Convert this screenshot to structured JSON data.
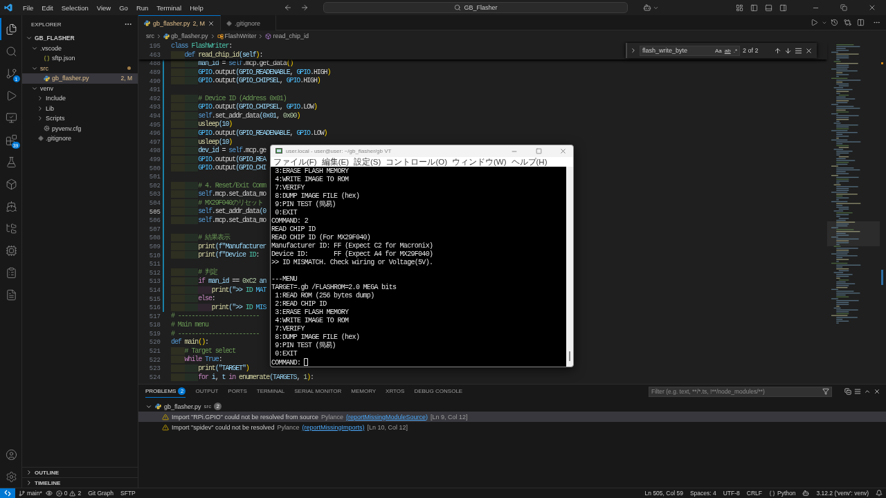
{
  "title_bar": {
    "menus": [
      "File",
      "Edit",
      "Selection",
      "View",
      "Go",
      "Run",
      "Terminal",
      "Help"
    ],
    "search": "GB_Flasher"
  },
  "activity_bar": [
    {
      "kind": "explorer",
      "selected": true
    },
    {
      "kind": "search",
      "selected": false
    },
    {
      "kind": "source_control",
      "selected": false,
      "badge": "1"
    },
    {
      "kind": "run",
      "selected": false
    },
    {
      "kind": "remote",
      "selected": false
    },
    {
      "kind": "extensions",
      "selected": false,
      "badge": "39"
    },
    {
      "kind": "testing",
      "selected": false
    },
    {
      "kind": "containers",
      "selected": false
    },
    {
      "kind": "docker",
      "selected": false
    },
    {
      "kind": "folders",
      "selected": false
    },
    {
      "kind": "device",
      "selected": false
    },
    {
      "kind": "clipboard",
      "selected": false
    },
    {
      "kind": "notes",
      "selected": false
    }
  ],
  "sidebar": {
    "title": "EXPLORER",
    "root": {
      "label": "GB_FLASHER",
      "expanded": true
    },
    "tree": [
      {
        "label": ".vscode",
        "kind": "folder",
        "expanded": true,
        "selected": false,
        "modified": false,
        "children": [
          {
            "label": "sftp.json",
            "kind": "json",
            "selected": false,
            "modified": false
          }
        ]
      },
      {
        "label": "src",
        "kind": "folder",
        "expanded": true,
        "selected": false,
        "modified": true,
        "children": [
          {
            "label": "gb_flasher.py",
            "kind": "python",
            "selected": true,
            "modified": true,
            "badge": "2, M"
          }
        ]
      },
      {
        "label": "venv",
        "kind": "folder",
        "expanded": true,
        "selected": false,
        "modified": false,
        "children": [
          {
            "label": "Include",
            "kind": "folder",
            "expanded": false,
            "selected": false,
            "modified": false
          },
          {
            "label": "Lib",
            "kind": "folder",
            "expanded": false,
            "selected": false,
            "modified": false
          },
          {
            "label": "Scripts",
            "kind": "folder",
            "expanded": false,
            "selected": false,
            "modified": false
          },
          {
            "label": "pyvenv.cfg",
            "kind": "config",
            "selected": false,
            "modified": false
          }
        ]
      },
      {
        "label": ".gitignore",
        "kind": "ignore",
        "selected": false,
        "modified": false
      }
    ],
    "sections": [
      {
        "label": "OUTLINE",
        "expanded": false
      },
      {
        "label": "TIMELINE",
        "expanded": false
      }
    ]
  },
  "tabs": [
    {
      "label": "gb_flasher.py",
      "kind": "python",
      "badge": "2, M",
      "selected": true,
      "modified": true
    },
    {
      "label": ".gitignore",
      "kind": "ignore",
      "selected": false,
      "modified": false
    }
  ],
  "breadcrumb": [
    {
      "label": "src",
      "kind": "folder"
    },
    {
      "label": "gb_flasher.py",
      "kind": "python"
    },
    {
      "label": "FlashWriter",
      "kind": "class"
    },
    {
      "label": "read_chip_id",
      "kind": "method"
    }
  ],
  "find": {
    "query": "flash_write_byte",
    "options": [
      "Aa",
      "ab",
      ".*"
    ],
    "count": "2 of 2"
  },
  "editor": {
    "sticky": [
      {
        "n": "195",
        "text": "class FlashWriter:"
      },
      {
        "n": "463",
        "text": "    def read_chip_id(self):"
      }
    ],
    "lines": [
      {
        "n": "488",
        "text": "        man_id = self.mcp.get_data()",
        "changed": true,
        "current": false
      },
      {
        "n": "489",
        "text": "        GPIO.output(GPIO_READENABLE, GPIO.HIGH)",
        "changed": true,
        "current": false
      },
      {
        "n": "490",
        "text": "        GPIO.output(GPIO_CHIPSEL, GPIO.HIGH)",
        "changed": true,
        "current": false
      },
      {
        "n": "491",
        "changed": true,
        "current": false
      },
      {
        "n": "492",
        "text": "        # Device ID (Address 0x01)",
        "changed": true,
        "current": false
      },
      {
        "n": "493",
        "text": "        GPIO.output(GPIO_CHIPSEL, GPIO.LOW)",
        "changed": true,
        "current": false
      },
      {
        "n": "494",
        "text": "        self.set_addr_data(0x01, 0x00)",
        "changed": true,
        "current": false
      },
      {
        "n": "495",
        "text": "        usleep(10)",
        "changed": true,
        "current": false
      },
      {
        "n": "496",
        "text": "        GPIO.output(GPIO_READENABLE, GPIO.LOW)",
        "changed": true,
        "current": false
      },
      {
        "n": "497",
        "text": "        usleep(10)",
        "changed": true,
        "current": false
      },
      {
        "n": "498",
        "text": "        dev_id = self.mcp.ge",
        "changed": true,
        "current": false
      },
      {
        "n": "499",
        "text": "        GPIO.output(GPIO_REA",
        "changed": true,
        "current": false
      },
      {
        "n": "500",
        "text": "        GPIO.output(GPIO_CHI",
        "changed": true,
        "current": false
      },
      {
        "n": "501",
        "changed": true,
        "current": false
      },
      {
        "n": "502",
        "text": "        # 4. Reset/Exit Comm",
        "changed": true,
        "current": false
      },
      {
        "n": "503",
        "text": "        self.mcp.set_data_mo",
        "changed": true,
        "current": false
      },
      {
        "n": "504",
        "text": "        # MX29F040のリセット",
        "changed": true,
        "current": false
      },
      {
        "n": "505",
        "text": "        self.set_addr_data(0",
        "changed": true,
        "current": true
      },
      {
        "n": "506",
        "text": "        self.mcp.set_data_mo",
        "changed": true,
        "current": false
      },
      {
        "n": "507",
        "changed": true,
        "current": false
      },
      {
        "n": "508",
        "text": "        # 結果表示",
        "changed": true,
        "current": false
      },
      {
        "n": "509",
        "text": "        print(f\"Manufacturer",
        "changed": true,
        "current": false
      },
      {
        "n": "510",
        "text": "        print(f\"Device ID:",
        "changed": true,
        "current": false
      },
      {
        "n": "511",
        "changed": true,
        "current": false
      },
      {
        "n": "512",
        "text": "        # 判定",
        "changed": true,
        "current": false
      },
      {
        "n": "513",
        "text": "        if man_id == 0xC2 an",
        "changed": true,
        "current": false
      },
      {
        "n": "514",
        "text": "            print(\">> ID MAT",
        "changed": true,
        "current": false
      },
      {
        "n": "515",
        "text": "        else:",
        "changed": true,
        "current": false
      },
      {
        "n": "516",
        "text": "            print(\">> ID MIS",
        "changed": true,
        "current": false
      },
      {
        "n": "517",
        "text": "# ------------------------",
        "changed": false,
        "current": false
      },
      {
        "n": "518",
        "text": "# Main menu",
        "changed": false,
        "current": false
      },
      {
        "n": "519",
        "text": "# ------------------------",
        "changed": false,
        "current": false
      },
      {
        "n": "520",
        "text": "def main():",
        "changed": false,
        "current": false
      },
      {
        "n": "521",
        "text": "    # Target select",
        "changed": false,
        "current": false
      },
      {
        "n": "522",
        "text": "    while True:",
        "changed": false,
        "current": false
      },
      {
        "n": "523",
        "text": "        print(\"TARGET\")",
        "changed": false,
        "current": false
      },
      {
        "n": "524",
        "text": "        for i, t in enumerate(TARGETS, 1):",
        "changed": false,
        "current": false
      }
    ]
  },
  "terminal": {
    "title": "user.local - user@user: ~/gb_flasher/gb VT",
    "menus": [
      "ファイル(F)",
      "編集(E)",
      "設定(S)",
      "コントロール(O)",
      "ウィンドウ(W)",
      "ヘルプ(H)"
    ],
    "blocks": [
      [
        " 3:ERASE FLASH MEMORY",
        " 4:WRITE IMAGE TO ROM",
        " 7:VERIFY",
        " 8:DUMP IMAGE FILE (hex)",
        " 9:PIN TEST (簡易)",
        " 0:EXIT",
        "COMMAND: 2",
        "READ CHIP ID",
        "READ CHIP ID (For MX29F040)",
        "Manufacturer ID: FF (Expect C2 for Macronix)",
        "Device ID:       FF (Expect A4 for MX29F040)",
        ">> ID MISMATCH. Check wiring or Voltage(5V)."
      ],
      [
        "---MENU",
        "TARGET=.gb /FLASHROM=2.0 MEGA bits",
        " 1:READ ROM (256 bytes dump)",
        " 2:READ CHIP ID",
        " 3:ERASE FLASH MEMORY",
        " 4:WRITE IMAGE TO ROM",
        " 7:VERIFY",
        " 8:DUMP IMAGE FILE (hex)",
        " 9:PIN TEST (簡易)",
        " 0:EXIT"
      ]
    ],
    "prompt": "COMMAND:"
  },
  "panel": {
    "tabs": [
      {
        "label": "PROBLEMS",
        "badge": "2",
        "selected": true
      },
      {
        "label": "OUTPUT",
        "selected": false
      },
      {
        "label": "PORTS",
        "selected": false
      },
      {
        "label": "TERMINAL",
        "selected": false
      },
      {
        "label": "SERIAL MONITOR",
        "selected": false
      },
      {
        "label": "MEMORY",
        "selected": false
      },
      {
        "label": "XRTOS",
        "selected": false
      },
      {
        "label": "DEBUG CONSOLE",
        "selected": false
      }
    ],
    "filter_placeholder": "Filter (e.g. text, **/*.ts, !**/node_modules/**)",
    "group": {
      "file": "gb_flasher.py",
      "folder": "src",
      "count": "2",
      "expanded": true,
      "items": [
        {
          "message": "Import \"RPi.GPIO\" could not be resolved from source",
          "source": "Pylance",
          "code": "(reportMissingModuleSource)",
          "location": "[Ln 9, Col 12]",
          "selected": true
        },
        {
          "message": "Import \"spidev\" could not be resolved",
          "source": "Pylance",
          "code": "(reportMissingImports)",
          "location": "[Ln 10, Col 12]",
          "selected": false
        }
      ]
    }
  },
  "status_bar": {
    "branch": "main*",
    "errors": "0",
    "warnings": "2",
    "left": [
      "Git Graph",
      "SFTP"
    ],
    "right": [
      {
        "kind": "text",
        "text": "Ln 505, Col 59"
      },
      {
        "kind": "text",
        "text": "Spaces: 4"
      },
      {
        "kind": "text",
        "text": "UTF-8"
      },
      {
        "kind": "text",
        "text": "CRLF"
      },
      {
        "kind": "language",
        "text": "Python"
      },
      {
        "kind": "copilot"
      },
      {
        "kind": "text",
        "text": "3.12.2 ('venv': venv)"
      },
      {
        "kind": "bell"
      }
    ]
  }
}
